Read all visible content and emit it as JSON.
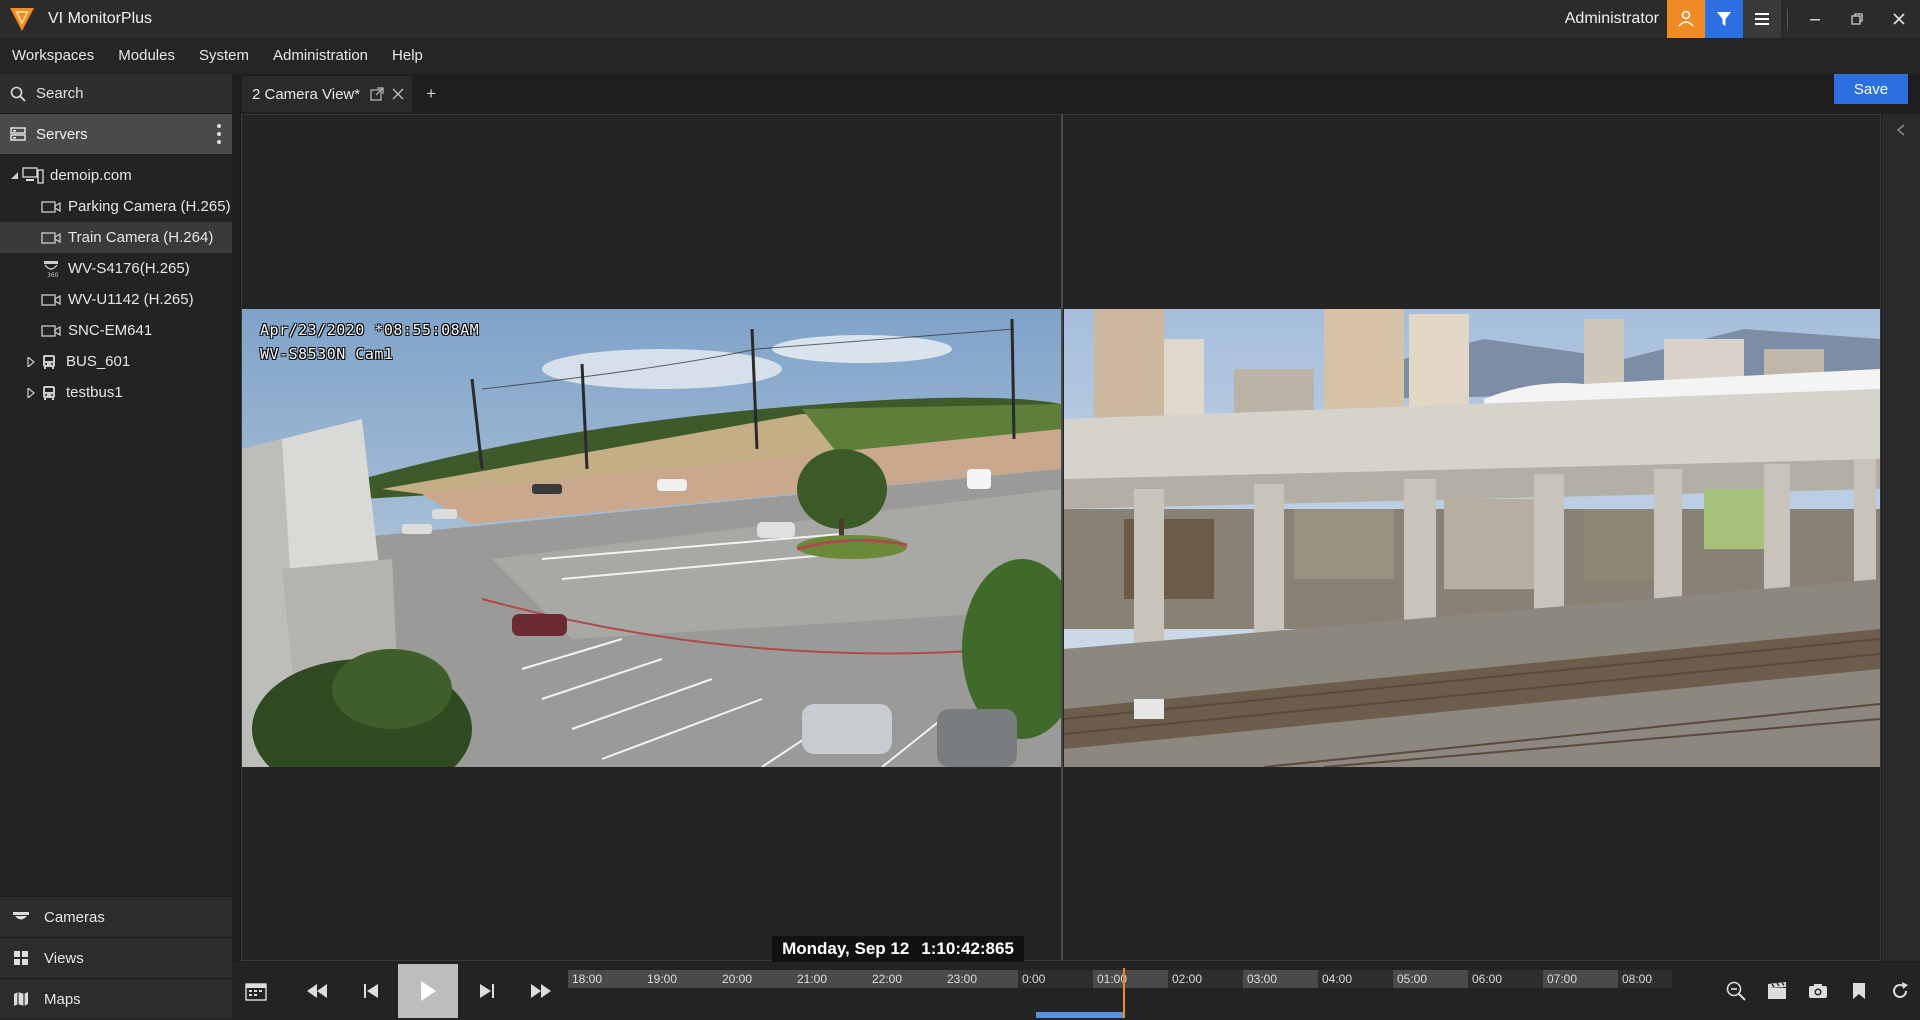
{
  "app": {
    "title": "VI MonitorPlus",
    "user": "Administrator"
  },
  "menu": [
    "Workspaces",
    "Modules",
    "System",
    "Administration",
    "Help"
  ],
  "sidebar": {
    "search_label": "Search",
    "servers_label": "Servers",
    "tree": [
      {
        "label": "demoip.com",
        "level": 0,
        "expanded": true,
        "icon": "server-icon"
      },
      {
        "label": "Parking Camera (H.265)",
        "level": 1,
        "icon": "camera-icon"
      },
      {
        "label": "Train Camera (H.264)",
        "level": 1,
        "icon": "camera-icon",
        "selected": true
      },
      {
        "label": "WV-S4176(H.265)",
        "level": 1,
        "icon": "dome-360-camera-icon"
      },
      {
        "label": "WV-U1142 (H.265)",
        "level": 1,
        "icon": "camera-icon"
      },
      {
        "label": "SNC-EM641",
        "level": 1,
        "icon": "camera-icon"
      },
      {
        "label": "BUS_601",
        "level": 1,
        "icon": "bus-icon",
        "collapsed": true
      },
      {
        "label": "testbus1",
        "level": 1,
        "icon": "bus-icon",
        "collapsed": true
      }
    ],
    "bottom_nav": [
      "Cameras",
      "Views",
      "Maps"
    ]
  },
  "tabs": {
    "active_label": "2 Camera View*",
    "add_label": "+",
    "save_label": "Save"
  },
  "viewer": {
    "cam1_osd_line1": "Apr/23/2020 *08:55:08AM",
    "cam1_osd_line2": "WV-S8530N Cam1",
    "date_label": "Monday, Sep 12",
    "time_label": "1:10:42:865"
  },
  "timeline": {
    "ticks": [
      "18:00",
      "19:00",
      "20:00",
      "21:00",
      "22:00",
      "23:00",
      "0:00",
      "01:00",
      "02:00",
      "03:00",
      "04:00",
      "05:00",
      "06:00",
      "07:00",
      "08:00"
    ]
  },
  "colors": {
    "accent_orange": "#f08a24",
    "accent_blue": "#2b6fe0",
    "recording_blue": "#5b8fe0"
  }
}
